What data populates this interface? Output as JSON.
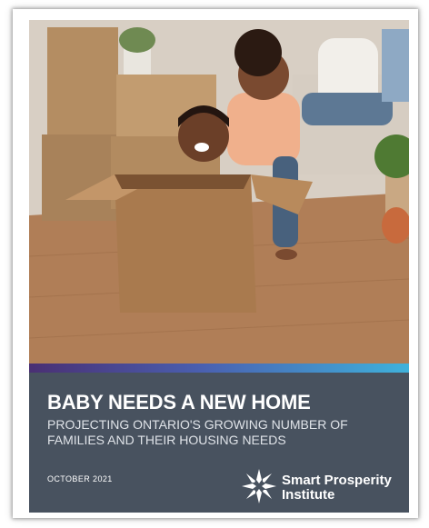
{
  "report": {
    "title": "BABY NEEDS A NEW HOME",
    "subtitle": "PROJECTING ONTARIO'S GROWING NUMBER OF FAMILIES AND THEIR HOUSING NEEDS",
    "date": "OCTOBER 2021"
  },
  "logo": {
    "line1": "Smart Prosperity",
    "line2": "Institute",
    "icon": "star-burst-icon"
  },
  "colors": {
    "panel": "#48525f",
    "stripe_start": "#4a2f73",
    "stripe_end": "#3fb2dc",
    "text": "#ffffff"
  }
}
